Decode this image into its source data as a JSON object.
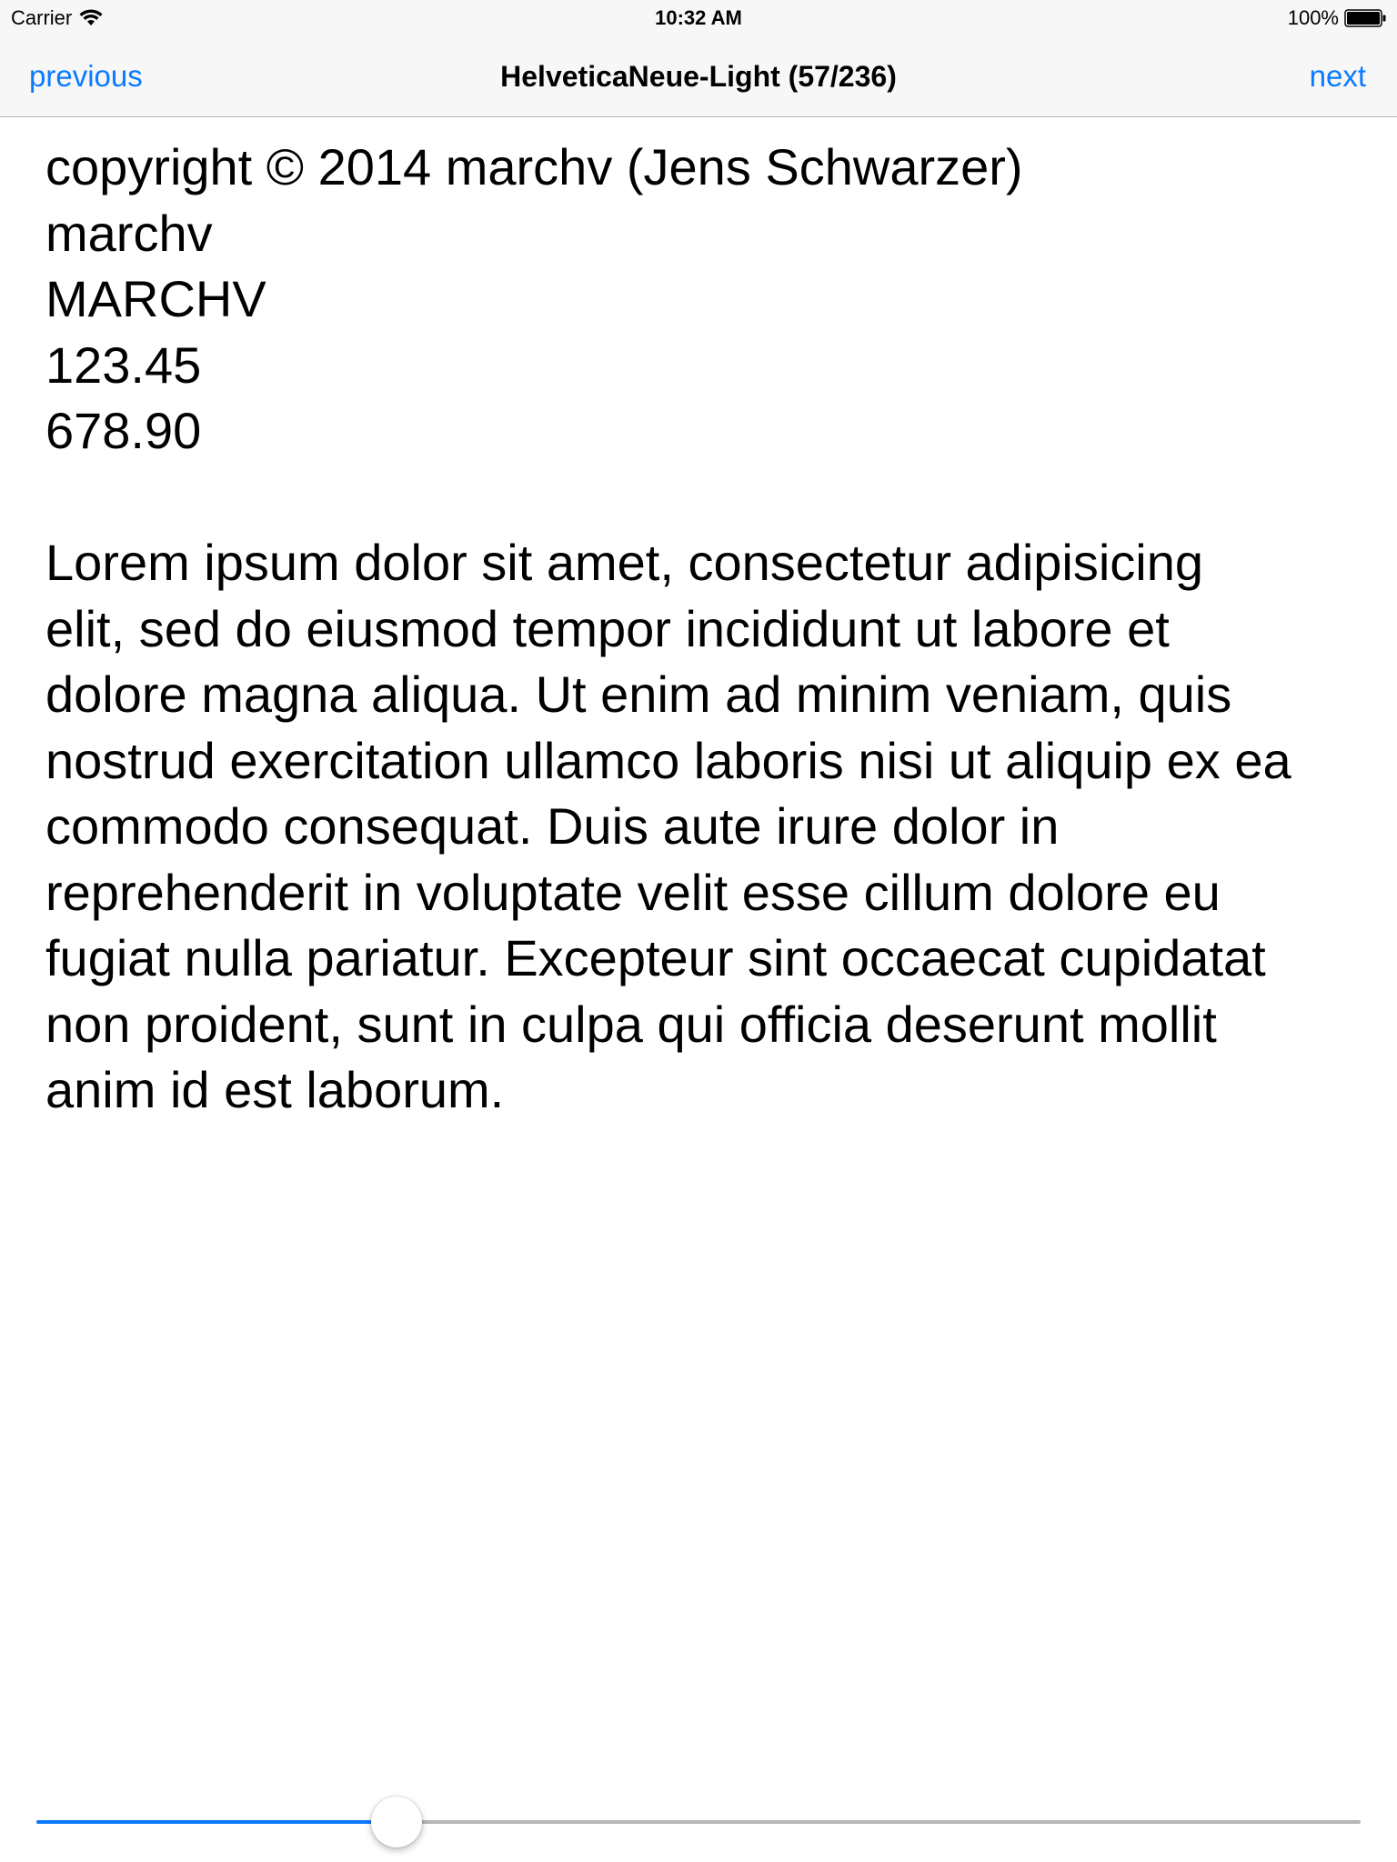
{
  "status_bar": {
    "carrier": "Carrier",
    "time": "10:32 AM",
    "battery": "100%"
  },
  "nav": {
    "previous_label": "previous",
    "title": "HelveticaNeue-Light (57/236)",
    "next_label": "next"
  },
  "content": {
    "lines": [
      "copyright © 2014 marchv (Jens Schwarzer)",
      "marchv",
      "MARCHV",
      "123.45",
      "678.90"
    ],
    "paragraph_lines": [
      "Lorem ipsum dolor sit amet, consectetur adipisicing",
      "elit, sed do eiusmod tempor incididunt ut labore et",
      "dolore magna aliqua. Ut enim ad minim veniam, quis",
      "nostrud exercitation ullamco laboris nisi ut aliquip ex ea",
      "commodo consequat. Duis aute irure dolor in",
      "reprehenderit in voluptate velit esse cillum dolore eu",
      "fugiat nulla pariatur. Excepteur sint occaecat cupidatat",
      "non proident, sunt in culpa qui officia deserunt mollit",
      "anim id est laborum."
    ]
  },
  "slider": {
    "value_fraction": 0.272
  },
  "colors": {
    "accent": "#0a7aff",
    "track": "#b6b6b6",
    "bar_background": "#f7f7f7"
  },
  "icons": {
    "wifi": "wifi-icon",
    "battery": "battery-icon"
  }
}
